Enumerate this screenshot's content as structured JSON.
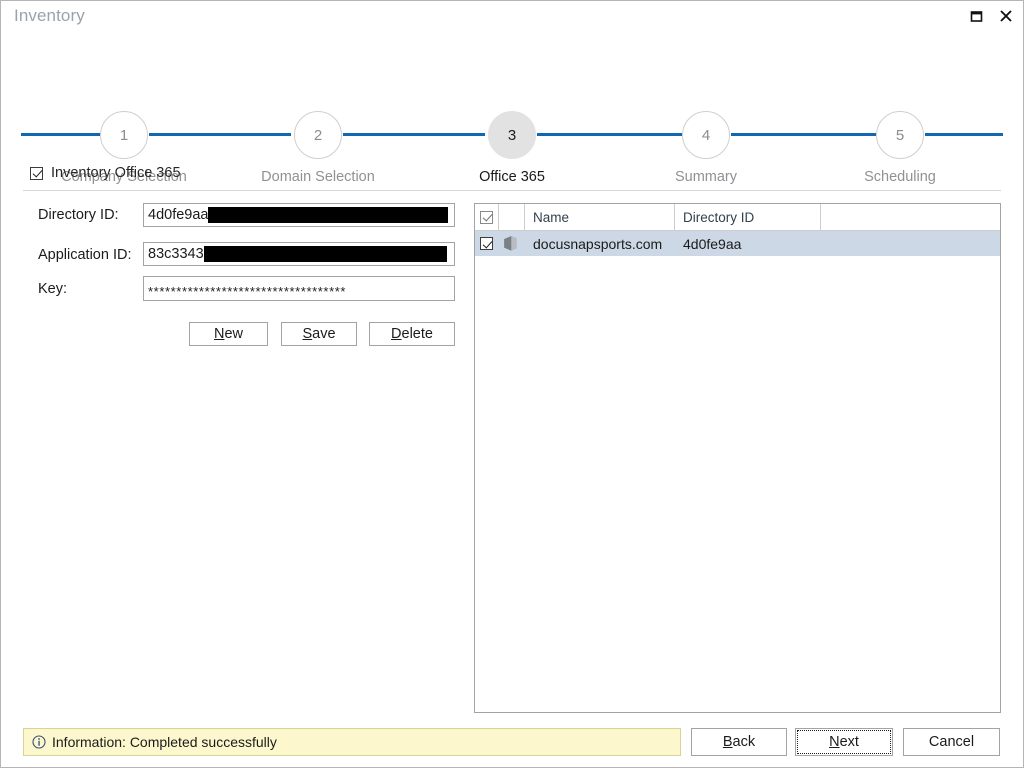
{
  "window": {
    "title": "Inventory",
    "controls": [
      {
        "name": "maximize-button",
        "icon": "maximize-icon"
      },
      {
        "name": "close-button",
        "icon": "close-icon"
      }
    ]
  },
  "stepper": {
    "active_index": 2,
    "line_color": "#1168b0",
    "steps": [
      {
        "number": "1",
        "label": "Company Selection",
        "active": false
      },
      {
        "number": "2",
        "label": "Domain Selection",
        "active": false
      },
      {
        "number": "3",
        "label": "Office 365",
        "active": true
      },
      {
        "number": "4",
        "label": "Summary",
        "active": false
      },
      {
        "number": "5",
        "label": "Scheduling",
        "active": false
      }
    ]
  },
  "section": {
    "checkbox_label": "Inventory Office 365",
    "checkbox_checked": true
  },
  "form": {
    "fields": [
      {
        "label": "Directory ID:",
        "value": "4d0fe9aa",
        "redacted": true
      },
      {
        "label": "Application ID:",
        "value": "83c3343",
        "redacted": true
      },
      {
        "label": "Key:",
        "value": "***********************************",
        "redacted": false
      }
    ],
    "buttons": [
      {
        "label": "New",
        "accel": "N"
      },
      {
        "label": "Save",
        "accel": "S"
      },
      {
        "label": "Delete",
        "accel": "D"
      }
    ]
  },
  "grid": {
    "header_checkbox_checked": true,
    "columns": [
      "",
      "",
      "Name",
      "Directory ID",
      ""
    ],
    "rows": [
      {
        "checked": true,
        "icon": "office365-icon",
        "name": "docusnapsports.com",
        "directory_id": "4d0fe9aa",
        "extra": "",
        "selected": true
      }
    ]
  },
  "footer": {
    "status": {
      "icon": "info-icon",
      "text": "Information: Completed successfully",
      "background": "#fdf7cd",
      "border": "#d9d29a"
    },
    "buttons": [
      {
        "label": "Back",
        "accel": "B",
        "focused": false
      },
      {
        "label": "Next",
        "accel": "N",
        "focused": true
      },
      {
        "label": "Cancel",
        "accel": "",
        "focused": false
      }
    ]
  }
}
